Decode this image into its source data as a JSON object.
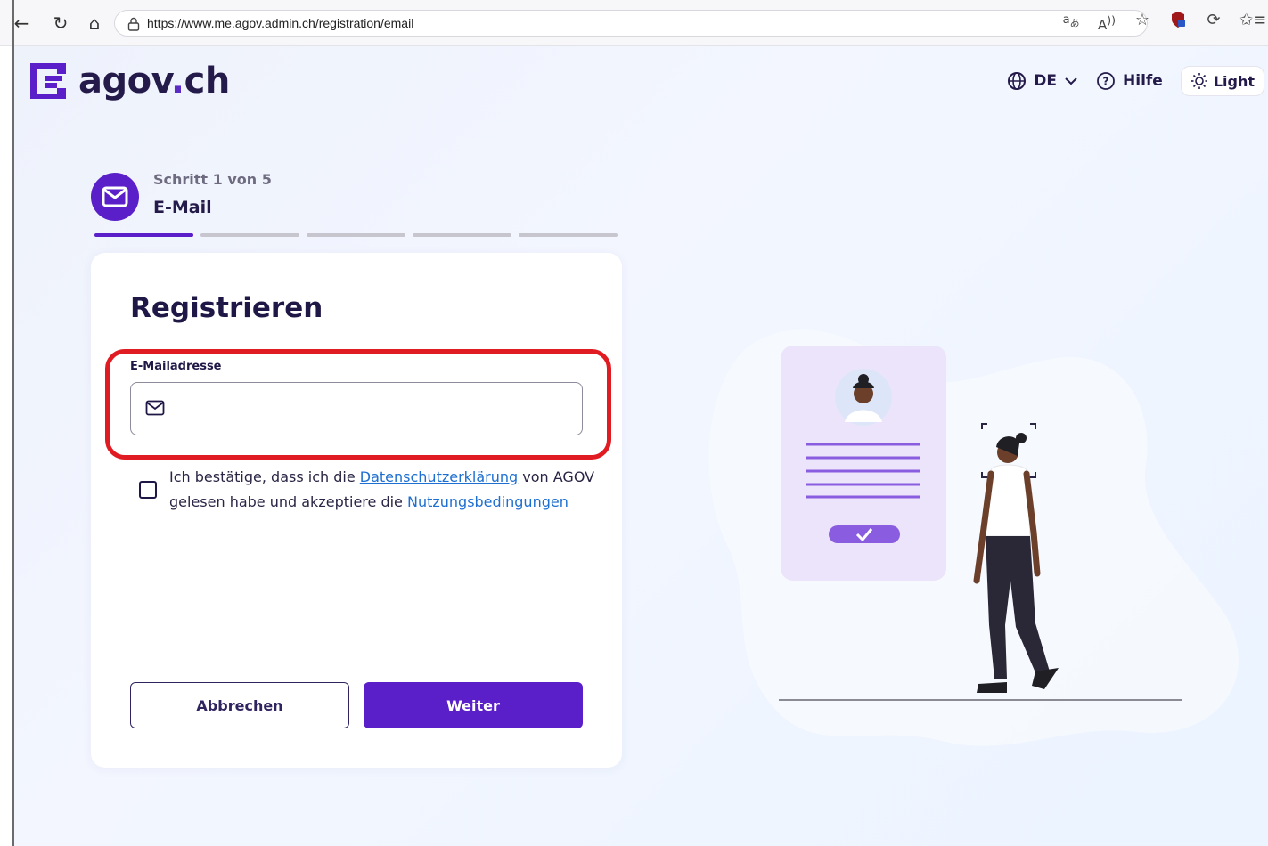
{
  "browser": {
    "url": "https://www.me.agov.admin.ch/registration/email"
  },
  "header": {
    "logo_text_main": "agov",
    "logo_text_dot": ".",
    "logo_text_tld": "ch",
    "lang": "DE",
    "help": "Hilfe",
    "theme": "Light"
  },
  "step": {
    "counter": "Schritt 1 von 5",
    "name": "E-Mail",
    "total_segments": 5,
    "active_segment": 1
  },
  "form": {
    "title": "Registrieren",
    "email_label": "E-Mailadresse",
    "email_value": "",
    "consent_pre": "Ich bestätige, dass ich die ",
    "consent_link1": "Datenschutzerklärung",
    "consent_mid": " von AGOV gelesen habe und akzeptiere die ",
    "consent_link2": "Nutzungsbedingungen",
    "cancel_label": "Abbrechen",
    "next_label": "Weiter"
  },
  "colors": {
    "brand": "#5a1fc9",
    "text_dark": "#1f1846",
    "highlight": "#e11b22",
    "link": "#1d6fd1"
  }
}
